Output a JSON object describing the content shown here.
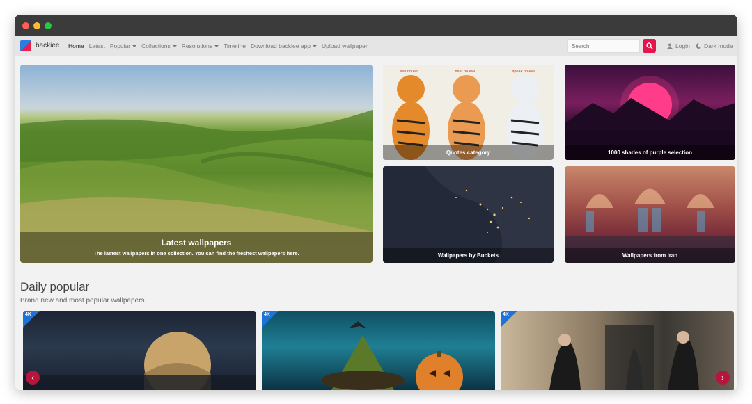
{
  "nav": {
    "brand": "backiee",
    "items": [
      "Home",
      "Latest",
      "Popular",
      "Collections",
      "Resolutions",
      "Timeline",
      "Download backiee app",
      "Upload wallpaper"
    ],
    "search_placeholder": "Search",
    "login": "Login",
    "dark_mode": "Dark mode"
  },
  "hero": {
    "title": "Latest wallpapers",
    "subtitle": "The lastest wallpapers in one collection. You can find the freshest wallpapers here."
  },
  "tiles": [
    "Quotes category",
    "1000 shades of purple selection",
    "Wallpapers by Buckets",
    "Wallpapers from Iran"
  ],
  "tile_text": {
    "tiger1": "see no evil...",
    "tiger2": "hear no evil...",
    "tiger3": "speak no evil..."
  },
  "daily": {
    "title": "Daily popular",
    "subtitle": "Brand new and most popular wallpapers",
    "badge": "4K"
  },
  "icons": {
    "search": "search-icon",
    "user": "user-icon",
    "moon": "moon-icon",
    "prev": "chevron-left-icon",
    "next": "chevron-right-icon"
  },
  "colors": {
    "accent": "#e4154d",
    "badge": "#1e73d8"
  }
}
